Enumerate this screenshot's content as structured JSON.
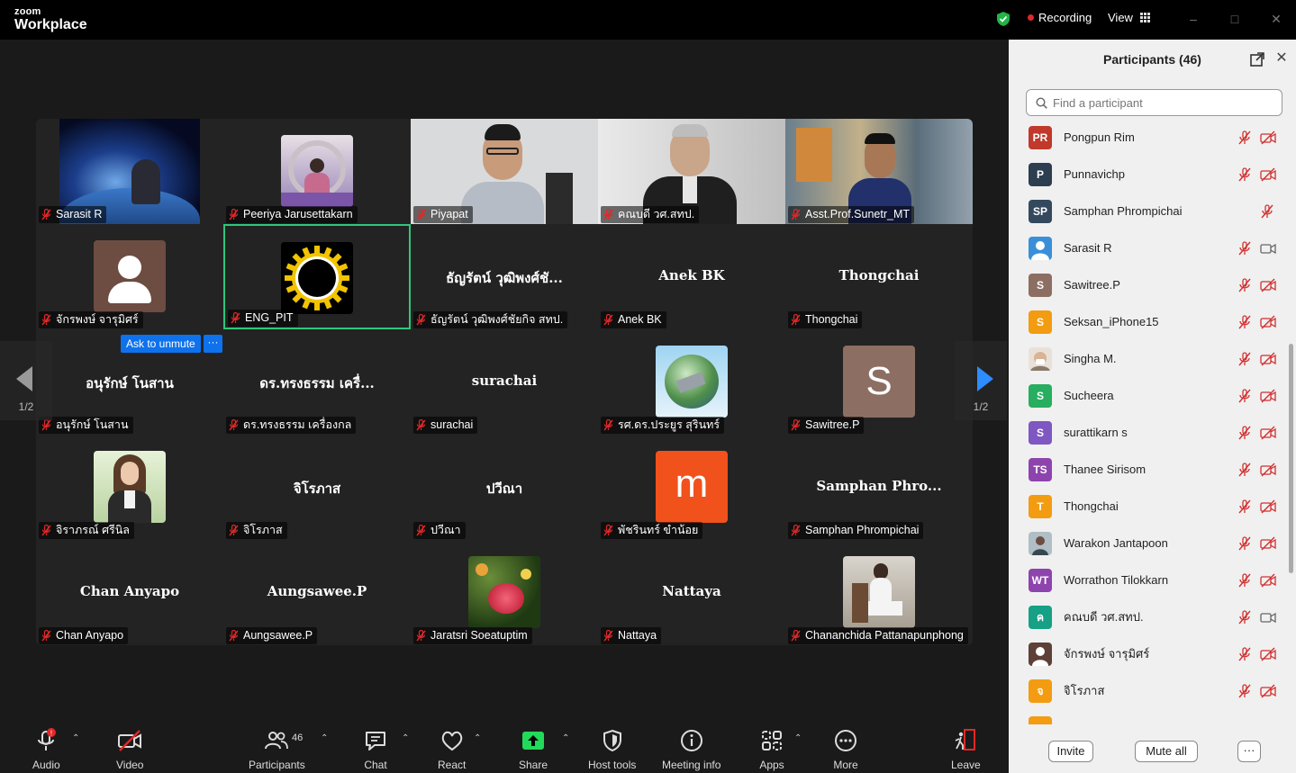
{
  "titlebar": {
    "brand_top": "zoom",
    "brand_bottom": "Workplace",
    "recording_label": "Recording",
    "view_label": "View"
  },
  "gallery": {
    "page_indicator_left": "1/2",
    "page_indicator_right": "1/2",
    "ask_to_unmute_label": "Ask to unmute",
    "more_label": "···",
    "tiles": [
      {
        "label": "Sarasit R",
        "big": ""
      },
      {
        "label": "Peeriya Jarusettakarn",
        "big": ""
      },
      {
        "label": "Piyapat",
        "big": ""
      },
      {
        "label": "คณบดี วศ.สทป.",
        "big": ""
      },
      {
        "label": "Asst.Prof.Sunetr_MT",
        "big": ""
      },
      {
        "label": "จักรพงษ์ จารุมิศร์",
        "big": ""
      },
      {
        "label": "ENG_PIT",
        "big": ""
      },
      {
        "label": "ธัญรัตน์ วุฒิพงศ์ชัยกิจ สทป.",
        "big": "ธัญรัตน์ วุฒิพงศ์ชั..."
      },
      {
        "label": "Anek BK",
        "big": "Anek BK"
      },
      {
        "label": "Thongchai",
        "big": "Thongchai"
      },
      {
        "label": "อนุรักษ์ โนสาน",
        "big": "อนุรักษ์ โนสาน"
      },
      {
        "label": "ดร.ทรงธรรม เครื่องกล",
        "big": "ดร.ทรงธรรม เครื่..."
      },
      {
        "label": "surachai",
        "big": "surachai"
      },
      {
        "label": "รศ.ดร.ประยูร สุรินทร์",
        "big": ""
      },
      {
        "label": "Sawitree.P",
        "big": "",
        "avatar_letter": "S"
      },
      {
        "label": "จิราภรณ์ ศรีนิล",
        "big": ""
      },
      {
        "label": "จิโรภาส",
        "big": "จิโรภาส"
      },
      {
        "label": "ปวีณา",
        "big": "ปวีณา"
      },
      {
        "label": "พัชรินทร์ ขำน้อย",
        "big": "",
        "avatar_letter": "m"
      },
      {
        "label": "Samphan Phrompichai",
        "big": "Samphan  Phro..."
      },
      {
        "label": "Chan Anyapo",
        "big": "Chan Anyapo"
      },
      {
        "label": "Aungsawee.P",
        "big": "Aungsawee.P"
      },
      {
        "label": "Jaratsri Soeatuptim",
        "big": ""
      },
      {
        "label": "Nattaya",
        "big": "Nattaya"
      },
      {
        "label": "Chananchida Pattanapunphong",
        "big": ""
      }
    ]
  },
  "toolbar": {
    "audio": "Audio",
    "audio_badge": "!",
    "video": "Video",
    "participants": "Participants",
    "participants_count": "46",
    "chat": "Chat",
    "react": "React",
    "share": "Share",
    "host_tools": "Host tools",
    "meeting_info": "Meeting info",
    "apps": "Apps",
    "more": "More",
    "leave": "Leave"
  },
  "panel": {
    "title": "Participants (46)",
    "search_placeholder": "Find a participant",
    "invite": "Invite",
    "mute_all": "Mute all",
    "more": "···",
    "participants": [
      {
        "initials": "PR",
        "name": "Pongpun Rim",
        "color": "#c0392b",
        "video": "off"
      },
      {
        "initials": "P",
        "name": "Punnavichp",
        "color": "#2c3e50",
        "video": "off"
      },
      {
        "initials": "SP",
        "name": "Samphan Phrompichai",
        "color": "#34495e",
        "video": "none"
      },
      {
        "initials": "",
        "name": "Sarasit R",
        "color": "#3a8fd8",
        "video": "on"
      },
      {
        "initials": "S",
        "name": "Sawitree.P",
        "color": "#8d6e63",
        "video": "off"
      },
      {
        "initials": "S",
        "name": "Seksan_iPhone15",
        "color": "#f39c12",
        "video": "off"
      },
      {
        "initials": "",
        "name": "Singha M.",
        "color": "#d7ccc8",
        "video": "off"
      },
      {
        "initials": "S",
        "name": "Sucheera",
        "color": "#27ae60",
        "video": "off"
      },
      {
        "initials": "S",
        "name": "surattikarn s",
        "color": "#7e57c2",
        "video": "off"
      },
      {
        "initials": "TS",
        "name": "Thanee Sirisom",
        "color": "#8e44ad",
        "video": "off"
      },
      {
        "initials": "T",
        "name": "Thongchai",
        "color": "#f39c12",
        "video": "off"
      },
      {
        "initials": "",
        "name": "Warakon Jantapoon",
        "color": "#90a4ae",
        "video": "off"
      },
      {
        "initials": "WT",
        "name": "Worrathon Tilokkarn",
        "color": "#8e44ad",
        "video": "off"
      },
      {
        "initials": "ค",
        "name": "คณบดี วศ.สทป.",
        "color": "#16a085",
        "video": "on"
      },
      {
        "initials": "",
        "name": "จักรพงษ์ จารุมิศร์",
        "color": "#5d4037",
        "video": "off"
      },
      {
        "initials": "จ",
        "name": "จิโรภาส",
        "color": "#f39c12",
        "video": "off"
      }
    ]
  },
  "colors": {
    "accent_blue": "#0e72ed",
    "active_speaker": "#2ec77b",
    "mute_red": "#e02828",
    "share_green": "#23d959"
  }
}
